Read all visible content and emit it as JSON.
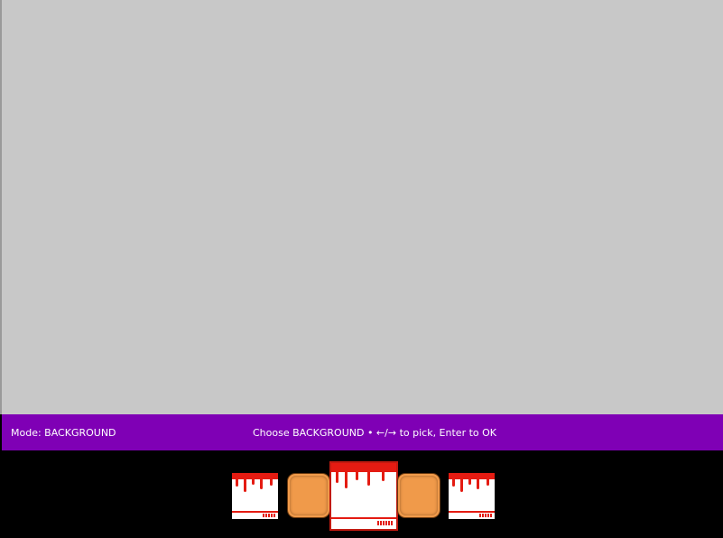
{
  "status_bar": {
    "mode_label": "Mode: BACKGROUND",
    "instructions": "Choose BACKGROUND • ←/→ to pick, Enter to OK",
    "color": "#7f00b5"
  },
  "canvas": {
    "background_color": "#c8c8c8"
  },
  "picker": {
    "selected_index": 2,
    "options": [
      {
        "kind": "white-red-drip",
        "icon": "drip-background-icon"
      },
      {
        "kind": "orange-rounded-square",
        "icon": "orange-tile-icon"
      },
      {
        "kind": "white-red-drip",
        "icon": "drip-background-icon"
      },
      {
        "kind": "orange-rounded-square",
        "icon": "orange-tile-icon"
      },
      {
        "kind": "white-red-drip",
        "icon": "drip-background-icon"
      }
    ],
    "colors": {
      "drip_red": "#e41b12",
      "orange": "#f09a4a",
      "selection_border": "#c21a10"
    }
  }
}
